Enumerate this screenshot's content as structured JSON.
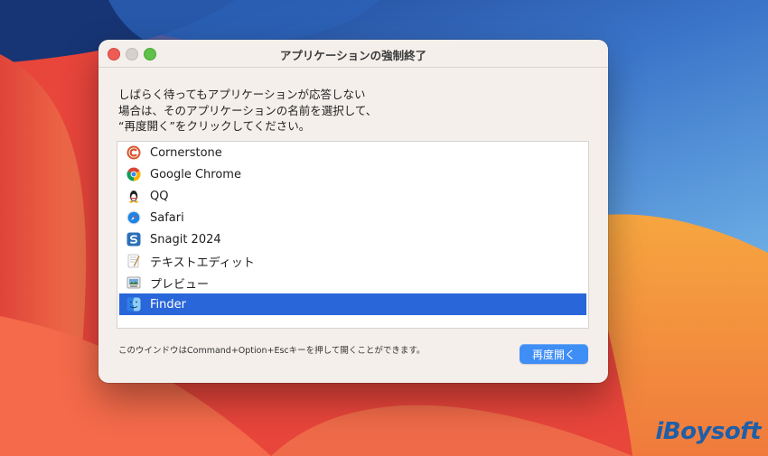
{
  "window": {
    "title": "アプリケーションの強制終了",
    "instructions": [
      "しばらく待ってもアプリケーションが応答しない",
      "場合は、そのアプリケーションの名前を選択して、",
      "“再度開く”をクリックしてください。"
    ],
    "apps": [
      {
        "label": "Cornerstone",
        "icon": "cornerstone-icon",
        "selected": false
      },
      {
        "label": "Google Chrome",
        "icon": "chrome-icon",
        "selected": false
      },
      {
        "label": "QQ",
        "icon": "qq-penguin-icon",
        "selected": false
      },
      {
        "label": "Safari",
        "icon": "safari-compass-icon",
        "selected": false
      },
      {
        "label": "Snagit 2024",
        "icon": "snagit-icon",
        "selected": false
      },
      {
        "label": "テキストエディット",
        "icon": "textedit-icon",
        "selected": false
      },
      {
        "label": "プレビュー",
        "icon": "preview-icon",
        "selected": false
      },
      {
        "label": "Finder",
        "icon": "finder-icon",
        "selected": true
      }
    ],
    "footer_note": "このウインドウはCommand+Option+Escキーを押して開くことができます。",
    "reopen_button": "再度開く"
  },
  "watermark": "iBoysoft",
  "colors": {
    "selection": "#2966d9",
    "button": "#3f8ef5",
    "close": "#ee5c55",
    "zoom": "#5fc148"
  }
}
